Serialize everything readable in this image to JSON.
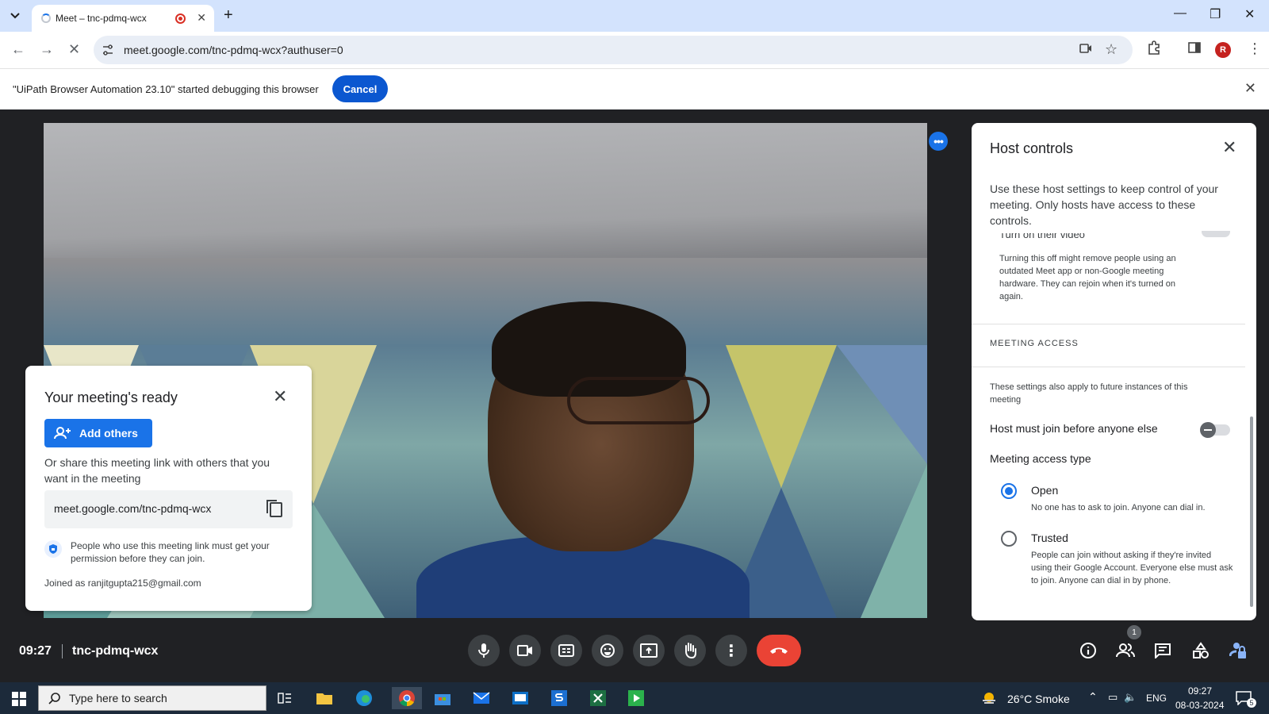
{
  "browser": {
    "tab_title": "Meet – tnc-pdmq-wcx",
    "new_tab": "+",
    "url": "meet.google.com/tnc-pdmq-wcx?authuser=0",
    "profile_initial": "R"
  },
  "infobar": {
    "message": "\"UiPath Browser Automation 23.10\" started debugging this browser",
    "cancel_label": "Cancel"
  },
  "meeting_ready": {
    "title": "Your meeting's ready",
    "add_others_label": "Add others",
    "share_text": "Or share this meeting link with others that you want in the meeting",
    "meeting_link": "meet.google.com/tnc-pdmq-wcx",
    "permission_text": "People who use this meeting link must get your permission before they can join.",
    "joined_as": "Joined as ranjitgupta215@gmail.com"
  },
  "host_controls": {
    "title": "Host controls",
    "description": "Use these host settings to keep control of your meeting. Only hosts have access to these controls.",
    "partial_label": "Turn on their video",
    "partial_note": "Turning this off might remove people using an outdated Meet app or non-Google meeting hardware. They can rejoin when it's turned on again.",
    "section_title": "MEETING ACCESS",
    "future_note": "These settings also apply to future instances of this meeting",
    "host_join_label": "Host must join before anyone else",
    "host_join_enabled": false,
    "access_type_label": "Meeting access type",
    "options": [
      {
        "title": "Open",
        "desc": "No one has to ask to join. Anyone can dial in.",
        "selected": true
      },
      {
        "title": "Trusted",
        "desc": "People can join without asking if they're invited using their Google Account. Everyone else must ask to join. Anyone can dial in by phone.",
        "selected": false
      }
    ]
  },
  "bottom_bar": {
    "time": "09:27",
    "meeting_code": "tnc-pdmq-wcx",
    "people_count": "1",
    "end_call_color": "#ea4335"
  },
  "taskbar": {
    "search_placeholder": "Type here to search",
    "weather": "26°C  Smoke",
    "language": "ENG",
    "time": "09:27",
    "date": "08-03-2024",
    "notifications": "5"
  },
  "colors": {
    "accent": "#1a73e8",
    "chrome_blue": "#0b57d0",
    "tab_strip": "#d3e3fd",
    "stage": "#202124"
  }
}
